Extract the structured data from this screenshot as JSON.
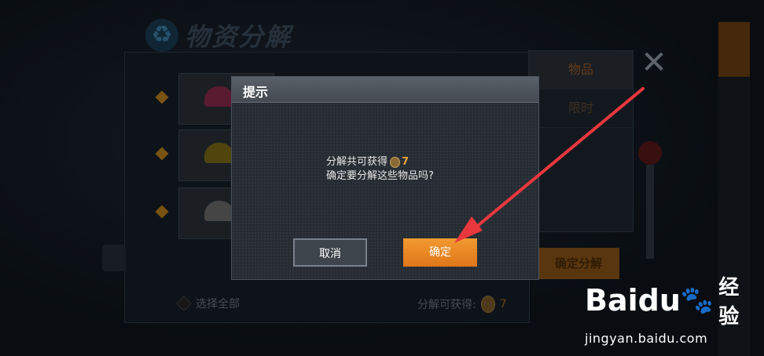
{
  "screen": {
    "title": "物资分解"
  },
  "side_panel": {
    "tabs": [
      "物品",
      "限时"
    ]
  },
  "footer": {
    "select_all_label": "选择全部",
    "gain_label": "分解可获得:",
    "gain_value": "7",
    "confirm_decompose_label": "确定分解"
  },
  "dialog": {
    "title": "提示",
    "message_line1": "分解共可获得",
    "reward_amount": "7",
    "message_line2": "确定要分解这些物品吗?",
    "cancel_label": "取消",
    "confirm_label": "确定"
  },
  "watermark": {
    "brand_text": "Baidu",
    "brand_cn": "经验",
    "url": "jingyan.baidu.com"
  },
  "colors": {
    "accent_orange": "#f29a30",
    "arrow_red": "#e8383d",
    "reward_text": "#f0a43a"
  }
}
